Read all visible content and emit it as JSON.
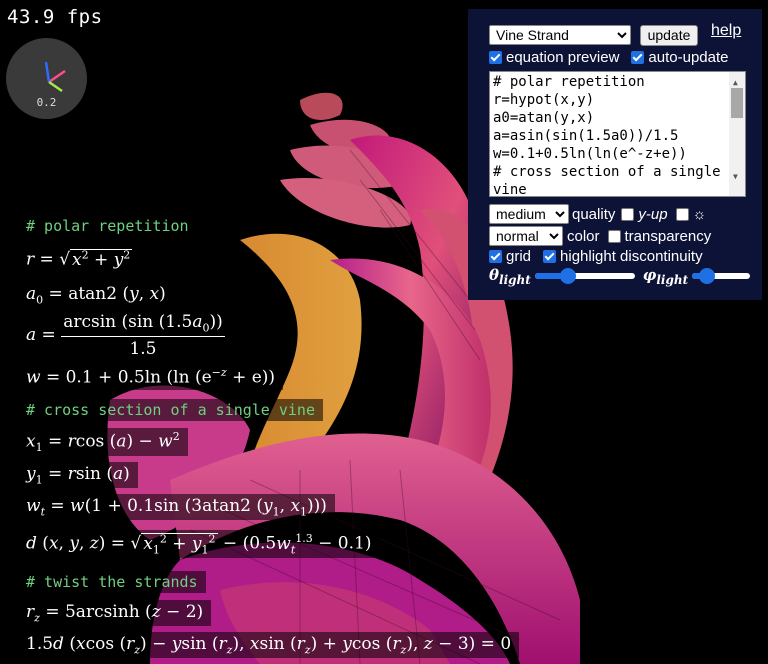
{
  "fps": "43.9 fps",
  "gizmo": {
    "value": "0.2",
    "icon": "axes-gizmo-icon"
  },
  "equations": {
    "comment1": "# polar repetition",
    "comment2": "# cross section of a single vine",
    "comment3": "# twist the strands"
  },
  "panel": {
    "preset_selected": "Vine Strand",
    "update_label": "update",
    "help_label": "help",
    "equation_preview_label": "equation preview",
    "equation_preview_checked": true,
    "auto_update_label": "auto-update",
    "auto_update_checked": true,
    "code": "# polar repetition\nr=hypot(x,y)\na0=atan(y,x)\na=asin(sin(1.5a0))/1.5\nw=0.1+0.5ln(ln(e^-z+e))\n# cross section of a single\nvine",
    "quality_selected": "medium",
    "quality_label": "quality",
    "yup_label": "y-up",
    "yup_checked": false,
    "light_checked": false,
    "light_icon": "sun-icon",
    "color_selected": "normal",
    "color_label": "color",
    "transparency_label": "transparency",
    "transparency_checked": false,
    "grid_label": "grid",
    "grid_checked": true,
    "highlight_label": "highlight discontinuity",
    "highlight_checked": true,
    "theta_label": "θ",
    "theta_sub": "light",
    "theta_value": 0.33,
    "phi_label": "φ",
    "phi_sub": "light",
    "phi_value": 0.25
  },
  "colors": {
    "panel_bg": "#0d1237",
    "accent": "#1f6fe5",
    "comment": "#6fd07f"
  }
}
